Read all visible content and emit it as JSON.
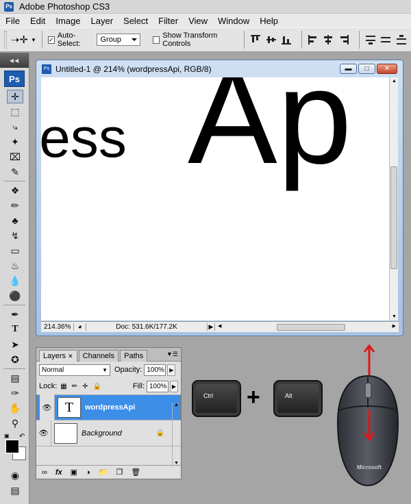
{
  "app": {
    "title": "Adobe Photoshop CS3"
  },
  "menu": [
    "File",
    "Edit",
    "Image",
    "Layer",
    "Select",
    "Filter",
    "View",
    "Window",
    "Help"
  ],
  "options": {
    "auto_select_label": "Auto-Select:",
    "auto_select_value": "Group",
    "show_transform_label": "Show Transform Controls"
  },
  "toolbox": {
    "logo": "Ps"
  },
  "document": {
    "title": "Untitled-1 @ 214% (wordpressApi, RGB/8)",
    "canvas_text_small": "ress",
    "canvas_text_large": "Ap",
    "zoom": "214.36%",
    "doc_size": "Doc: 531.6K/177.2K"
  },
  "layers_panel": {
    "tabs": [
      "Layers",
      "Channels",
      "Paths"
    ],
    "blend_mode": "Normal",
    "opacity_label": "Opacity:",
    "opacity_value": "100%",
    "lock_label": "Lock:",
    "fill_label": "Fill:",
    "fill_value": "100%",
    "layers": [
      {
        "name": "wordpressApi",
        "type": "text",
        "selected": true,
        "thumb": "T"
      },
      {
        "name": "Background",
        "type": "image",
        "selected": false,
        "locked": true
      }
    ]
  },
  "keys": {
    "ctrl": "Ctrl",
    "alt": "Alt",
    "plus": "+"
  },
  "mouse": {
    "brand": "Microsoft"
  },
  "colors": {
    "selection": "#3d8ee6",
    "arrow": "#e0161b",
    "ps_blue": "#1d5cb0"
  }
}
